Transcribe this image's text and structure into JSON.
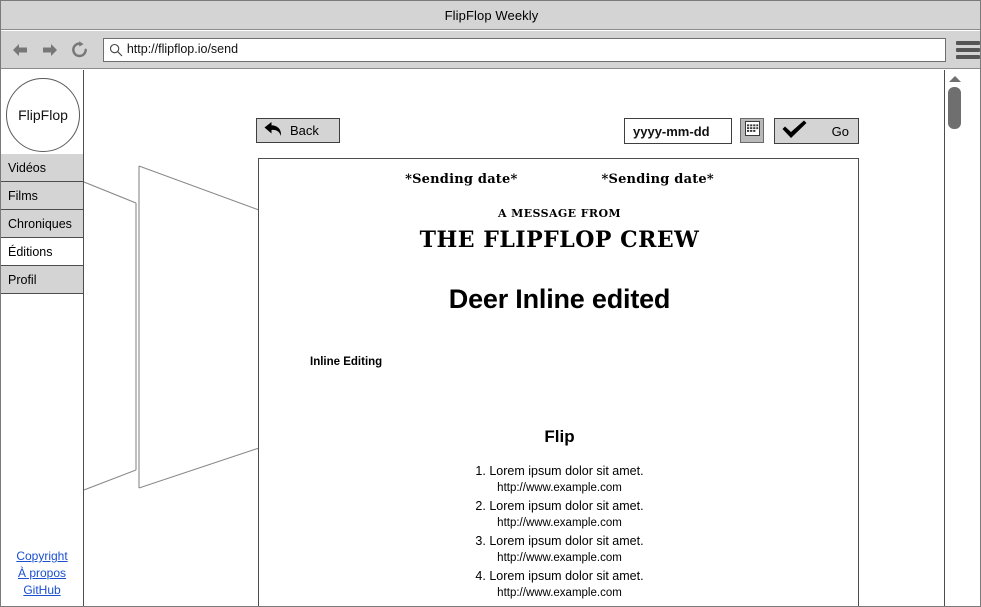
{
  "window": {
    "title": "FlipFlop Weekly"
  },
  "browser": {
    "back_icon": "arrow-left-icon",
    "forward_icon": "arrow-right-icon",
    "reload_icon": "reload-icon",
    "search_icon": "search-icon",
    "url": "http://flipflop.io/send",
    "menu_icon": "hamburger-menu-icon"
  },
  "sidebar": {
    "logo": "FlipFlop",
    "items": [
      {
        "label": "Vidéos",
        "active": false
      },
      {
        "label": "Films",
        "active": false
      },
      {
        "label": "Chroniques",
        "active": false
      },
      {
        "label": "Éditions",
        "active": true
      },
      {
        "label": "Profil",
        "active": false
      }
    ],
    "links": [
      {
        "label": "Copyright"
      },
      {
        "label": "À propos"
      },
      {
        "label": "GitHub"
      }
    ]
  },
  "toolbar": {
    "back_label": "Back",
    "back_icon": "back-arrow-icon",
    "date_value": "yyyy-mm-dd",
    "date_placeholder": "yyyy-mm-dd",
    "calendar_icon": "calendar-icon",
    "go_label": "Go",
    "go_icon": "checkmark-icon"
  },
  "newsletter": {
    "sending_date_left": "*Sending date*",
    "sending_date_right": "*Sending date*",
    "message_from": "A MESSAGE FROM",
    "crew": "THE FLIPFLOP CREW",
    "headline": "Deer Inline edited",
    "inline_editing_label": "Inline Editing",
    "section_heading": "Flip",
    "items": [
      {
        "number": "1.",
        "title": "Lorem ipsum dolor sit amet.",
        "url": "http://www.example.com"
      },
      {
        "number": "2.",
        "title": "Lorem ipsum dolor sit amet.",
        "url": "http://www.example.com"
      },
      {
        "number": "3.",
        "title": "Lorem ipsum dolor sit amet.",
        "url": "http://www.example.com"
      },
      {
        "number": "4.",
        "title": "Lorem ipsum dolor sit amet.",
        "url": "http://www.example.com"
      }
    ]
  },
  "scrollbar": {
    "up_arrow_icon": "scroll-up-arrow-icon",
    "thumb": "scrollbar-thumb"
  },
  "colors": {
    "chrome_bg": "#d4d4d4",
    "link": "#1a4fd0",
    "border": "#4d4d4d",
    "scrollbar_thumb": "#6f6f6f"
  }
}
